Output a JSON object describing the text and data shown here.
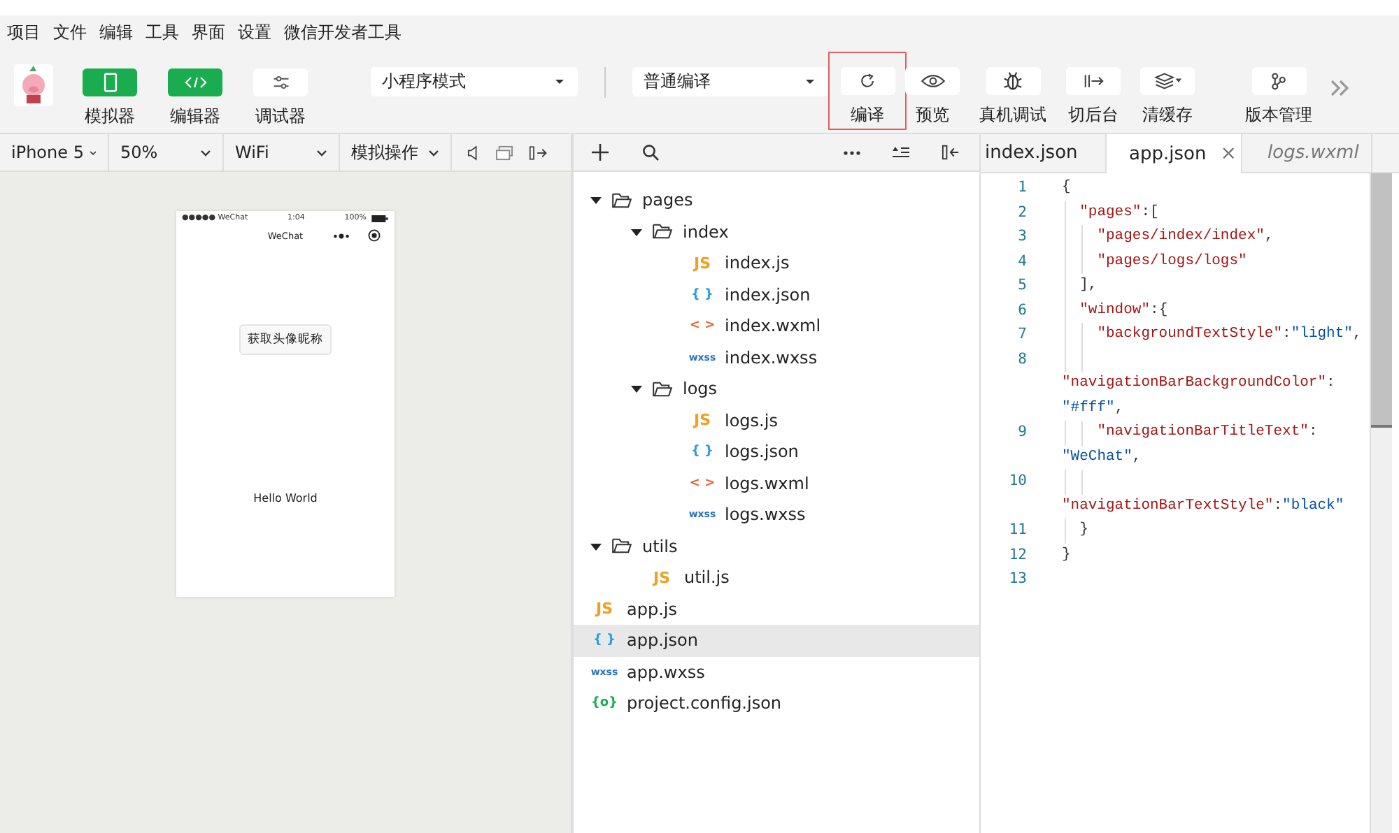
{
  "menu": [
    "项目",
    "文件",
    "编辑",
    "工具",
    "界面",
    "设置",
    "微信开发者工具"
  ],
  "toolbar": {
    "left": [
      {
        "label": "模拟器",
        "active": true
      },
      {
        "label": "编辑器",
        "active": true
      },
      {
        "label": "调试器",
        "active": false
      }
    ],
    "mode_select": {
      "value": "小程序模式"
    },
    "compile_select": {
      "value": "普通编译"
    },
    "right": [
      {
        "label": "编译",
        "highlighted": true
      },
      {
        "label": "预览",
        "highlighted": false
      },
      {
        "label": "真机调试",
        "highlighted": false
      },
      {
        "label": "切后台",
        "highlighted": false
      },
      {
        "label": "清缓存",
        "highlighted": false
      },
      {
        "label": "版本管理",
        "highlighted": false
      }
    ]
  },
  "simulator": {
    "selects": [
      {
        "value": "iPhone 5"
      },
      {
        "value": "50%"
      },
      {
        "value": "WiFi"
      },
      {
        "value": "模拟操作"
      }
    ],
    "phone": {
      "carrier": "●●●●● WeChat",
      "time": "1:04",
      "battery": "100%",
      "nav_title": "WeChat",
      "button": "获取头像昵称",
      "text": "Hello World"
    }
  },
  "tree": [
    {
      "name": "pages",
      "kind": "folder",
      "expanded": true,
      "selected": false,
      "children": [
        {
          "name": "index",
          "kind": "folder",
          "expanded": true,
          "selected": false,
          "children": [
            {
              "name": "index.js",
              "kind": "js",
              "badge": "JS",
              "selected": false
            },
            {
              "name": "index.json",
              "kind": "json",
              "badge": "{ }",
              "selected": false
            },
            {
              "name": "index.wxml",
              "kind": "wxml",
              "badge": "< >",
              "selected": false
            },
            {
              "name": "index.wxss",
              "kind": "wxss",
              "badge": "wxss",
              "selected": false
            }
          ]
        },
        {
          "name": "logs",
          "kind": "folder",
          "expanded": true,
          "selected": false,
          "children": [
            {
              "name": "logs.js",
              "kind": "js",
              "badge": "JS",
              "selected": false
            },
            {
              "name": "logs.json",
              "kind": "json",
              "badge": "{ }",
              "selected": false
            },
            {
              "name": "logs.wxml",
              "kind": "wxml",
              "badge": "< >",
              "selected": false
            },
            {
              "name": "logs.wxss",
              "kind": "wxss",
              "badge": "wxss",
              "selected": false
            }
          ]
        }
      ]
    },
    {
      "name": "utils",
      "kind": "folder",
      "expanded": true,
      "selected": false,
      "children": [
        {
          "name": "util.js",
          "kind": "js",
          "badge": "JS",
          "selected": false
        }
      ]
    },
    {
      "name": "app.js",
      "kind": "js",
      "badge": "JS",
      "selected": false
    },
    {
      "name": "app.json",
      "kind": "json",
      "badge": "{ }",
      "selected": true
    },
    {
      "name": "app.wxss",
      "kind": "wxss",
      "badge": "wxss",
      "selected": false
    },
    {
      "name": "project.config.json",
      "kind": "config",
      "badge": "{o}",
      "selected": false
    }
  ],
  "tabs": [
    {
      "label": "index.json",
      "selected": false,
      "preview": false
    },
    {
      "label": "app.json",
      "selected": true,
      "preview": false,
      "close": "×"
    },
    {
      "label": "logs.wxml",
      "selected": false,
      "preview": true
    }
  ],
  "code": [
    {
      "number": "1",
      "rows": [
        {
          "parts": [
            {
              "t": "{",
              "kind": "punct"
            }
          ]
        }
      ]
    },
    {
      "number": "2",
      "rows": [
        {
          "parts": [
            {
              "t": "  \"pages\"",
              "kind": "key"
            },
            {
              "t": ":[",
              "kind": "punct"
            }
          ]
        }
      ]
    },
    {
      "number": "3",
      "rows": [
        {
          "parts": [
            {
              "t": "    \"pages/index/index\"",
              "kind": "key"
            },
            {
              "t": ",",
              "kind": "punct"
            }
          ]
        }
      ]
    },
    {
      "number": "4",
      "rows": [
        {
          "parts": [
            {
              "t": "    \"pages/logs/logs\"",
              "kind": "key"
            }
          ]
        }
      ]
    },
    {
      "number": "5",
      "rows": [
        {
          "parts": [
            {
              "t": "  ],",
              "kind": "punct"
            }
          ]
        }
      ]
    },
    {
      "number": "6",
      "rows": [
        {
          "parts": [
            {
              "t": "  \"window\"",
              "kind": "key"
            },
            {
              "t": ":{",
              "kind": "punct"
            }
          ]
        }
      ]
    },
    {
      "number": "7",
      "rows": [
        {
          "parts": [
            {
              "t": "    \"backgroundTextStyle\"",
              "kind": "key"
            },
            {
              "t": ":",
              "kind": "punct"
            },
            {
              "t": "\"light\"",
              "kind": "str"
            },
            {
              "t": ",",
              "kind": "punct"
            }
          ]
        }
      ]
    },
    {
      "number": "8",
      "rows": [
        {},
        {
          "parts": [
            {
              "t": "\"navigationBarBackgroundColor\"",
              "kind": "key"
            },
            {
              "t": ":",
              "kind": "punct"
            }
          ]
        },
        {
          "parts": [
            {
              "t": "\"#fff\"",
              "kind": "str"
            },
            {
              "t": ",",
              "kind": "punct"
            }
          ]
        }
      ]
    },
    {
      "number": "9",
      "rows": [
        {
          "parts": [
            {
              "t": "    \"navigationBarTitleText\"",
              "kind": "key"
            },
            {
              "t": ":",
              "kind": "punct"
            }
          ]
        },
        {
          "parts": [
            {
              "t": "\"WeChat\"",
              "kind": "str"
            },
            {
              "t": ",",
              "kind": "punct"
            }
          ]
        }
      ]
    },
    {
      "number": "10",
      "rows": [
        {},
        {
          "parts": [
            {
              "t": "\"navigationBarTextStyle\"",
              "kind": "key"
            },
            {
              "t": ":",
              "kind": "punct"
            },
            {
              "t": "\"black\"",
              "kind": "str"
            }
          ]
        }
      ]
    },
    {
      "number": "11",
      "rows": [
        {
          "parts": [
            {
              "t": "  }",
              "kind": "punct"
            }
          ]
        }
      ]
    },
    {
      "number": "12",
      "rows": [
        {
          "parts": [
            {
              "t": "}",
              "kind": "punct"
            }
          ]
        }
      ]
    },
    {
      "number": "13",
      "rows": [
        {}
      ]
    }
  ]
}
